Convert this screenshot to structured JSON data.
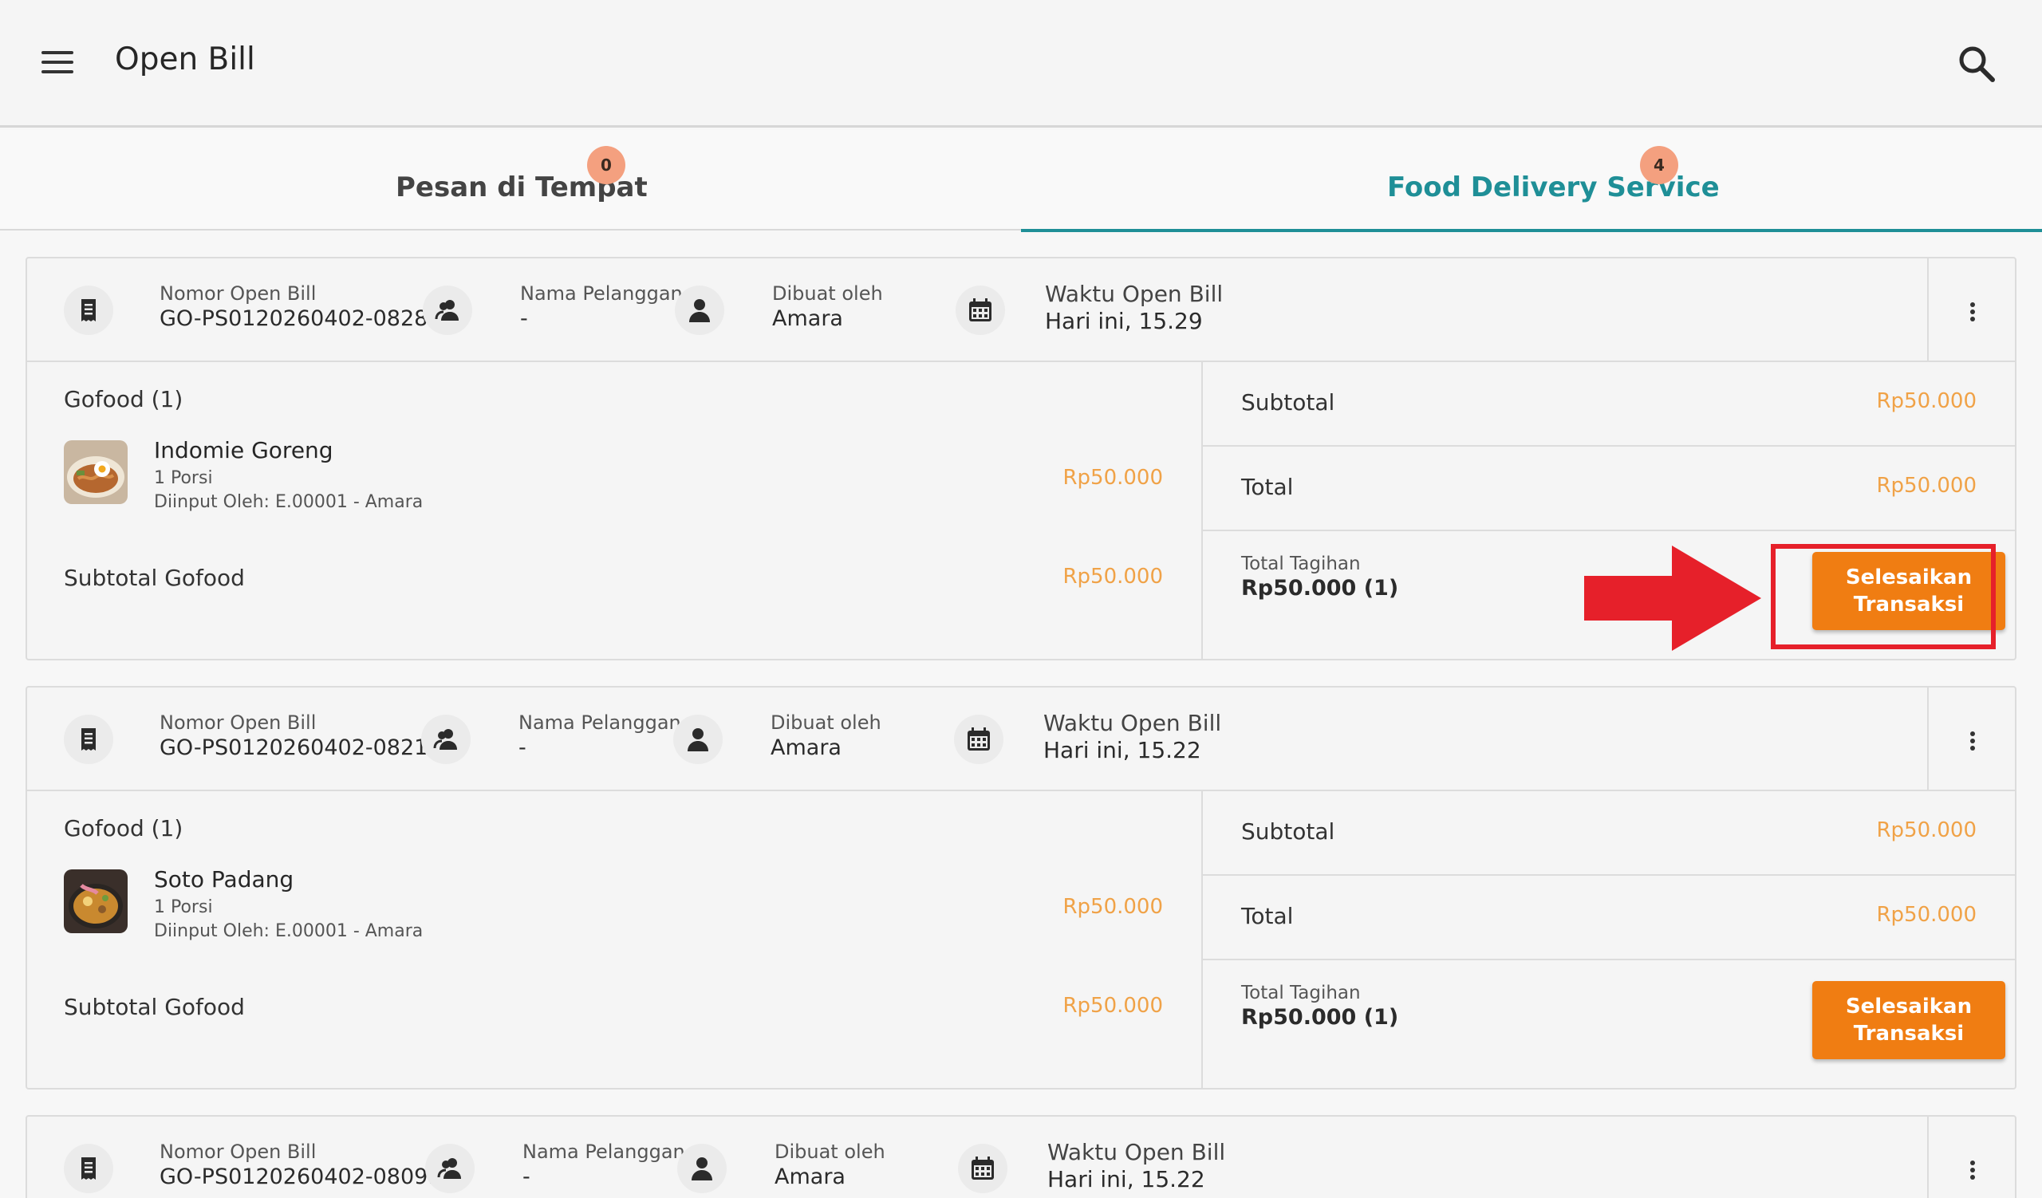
{
  "app": {
    "title": "Open Bill"
  },
  "tabs": [
    {
      "label": "Pesan di Tempat",
      "badge": "0",
      "active": false
    },
    {
      "label": "Food Delivery Service",
      "badge": "4",
      "active": true
    }
  ],
  "colors": {
    "accent": "#1f8f97",
    "price": "#f0a247",
    "primary_button": "#f07d12",
    "badge": "#f4a07f",
    "highlight": "#e6202a"
  },
  "bills": [
    {
      "header": {
        "bill_number_label": "Nomor Open Bill",
        "bill_number": "GO-PS0120260402-0828...",
        "customer_label": "Nama Pelanggan",
        "customer": "-",
        "created_by_label": "Dibuat oleh",
        "created_by": "Amara",
        "time_label": "Waktu Open Bill",
        "time": "Hari ini, 15.29"
      },
      "group_title": "Gofood (1)",
      "item": {
        "name": "Indomie Goreng",
        "qty": "1 Porsi",
        "input_by": "Diinput Oleh:  E.00001 - Amara",
        "price": "Rp50.000",
        "thumb_icon": "noodle-dish-photo"
      },
      "group_subtotal_label": "Subtotal Gofood",
      "group_subtotal": "Rp50.000",
      "subtotal_label": "Subtotal",
      "subtotal": "Rp50.000",
      "total_label": "Total",
      "total": "Rp50.000",
      "tagihan_label": "Total Tagihan",
      "tagihan": "Rp50.000 (1)",
      "button_line1": "Selesaikan",
      "button_line2": "Transaksi"
    },
    {
      "header": {
        "bill_number_label": "Nomor Open Bill",
        "bill_number": "GO-PS0120260402-0821...",
        "customer_label": "Nama Pelanggan",
        "customer": "-",
        "created_by_label": "Dibuat oleh",
        "created_by": "Amara",
        "time_label": "Waktu Open Bill",
        "time": "Hari ini, 15.22"
      },
      "group_title": "Gofood (1)",
      "item": {
        "name": "Soto Padang",
        "qty": "1 Porsi",
        "input_by": "Diinput Oleh:  E.00001 - Amara",
        "price": "Rp50.000",
        "thumb_icon": "soup-dish-photo"
      },
      "group_subtotal_label": "Subtotal Gofood",
      "group_subtotal": "Rp50.000",
      "subtotal_label": "Subtotal",
      "subtotal": "Rp50.000",
      "total_label": "Total",
      "total": "Rp50.000",
      "tagihan_label": "Total Tagihan",
      "tagihan": "Rp50.000 (1)",
      "button_line1": "Selesaikan",
      "button_line2": "Transaksi"
    },
    {
      "header": {
        "bill_number_label": "Nomor Open Bill",
        "bill_number": "GO-PS0120260402-0809...",
        "customer_label": "Nama Pelanggan",
        "customer": "-",
        "created_by_label": "Dibuat oleh",
        "created_by": "Amara",
        "time_label": "Waktu Open Bill",
        "time": "Hari ini, 15.22"
      }
    }
  ]
}
